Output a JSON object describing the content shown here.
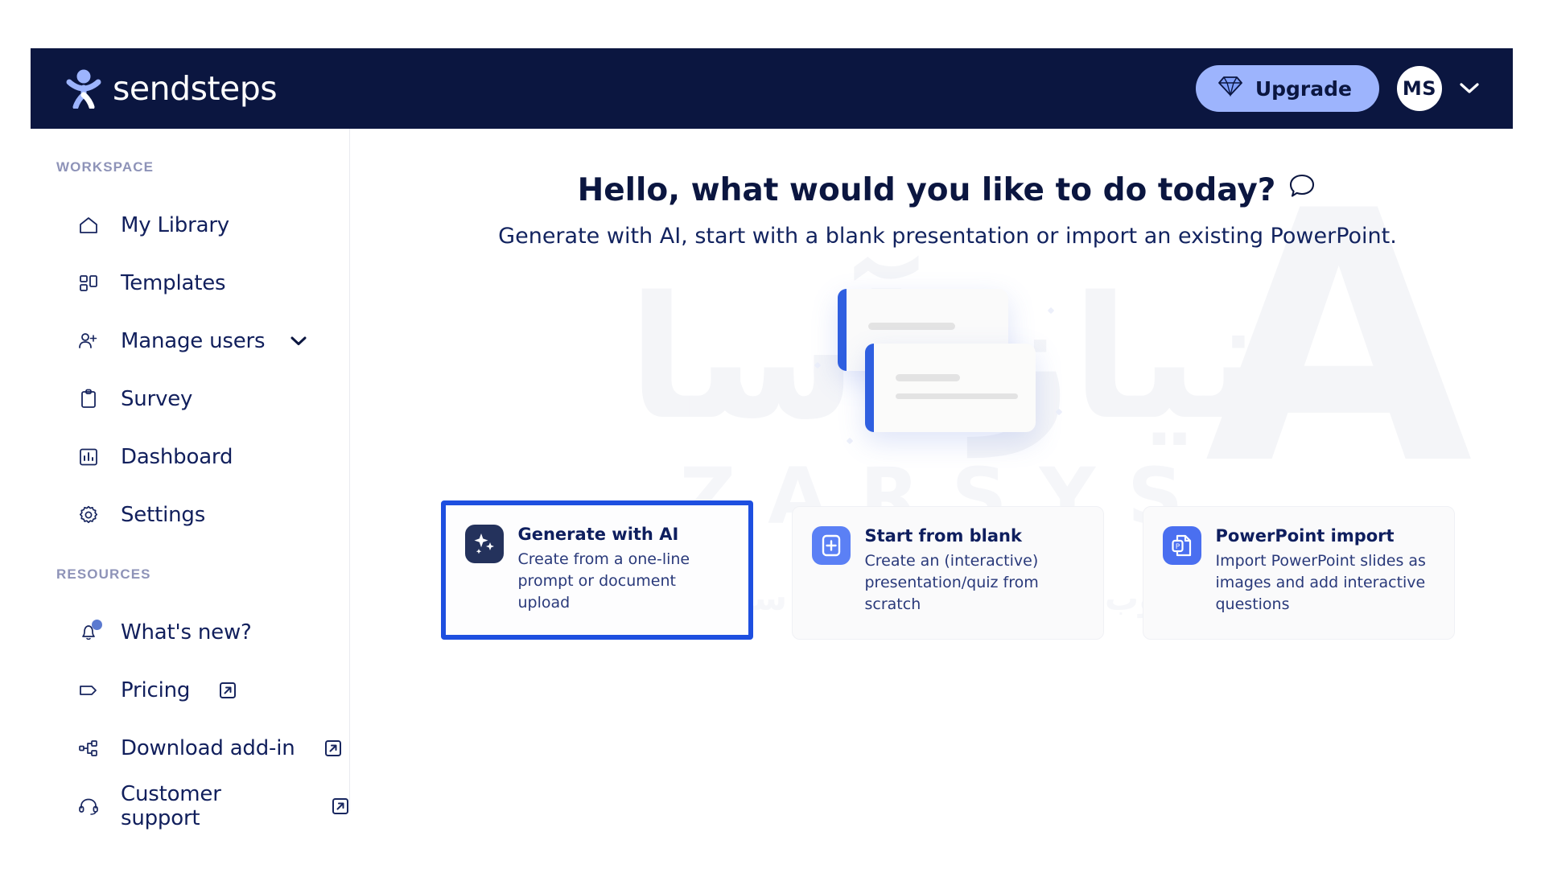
{
  "brand": {
    "name": "sendsteps",
    "logo_icon": "sendsteps-person-logo",
    "header_bg": "#0b1640",
    "accent": "#1e4fe0",
    "upgrade_bg": "#9db4fd"
  },
  "header": {
    "upgrade_label": "Upgrade",
    "upgrade_icon": "diamond-icon",
    "avatar_initials": "MS",
    "account_chevron_icon": "chevron-down-icon"
  },
  "sidebar": {
    "workspace_label": "WORKSPACE",
    "resources_label": "RESOURCES",
    "workspace_items": [
      {
        "label": "My Library",
        "icon": "home-icon",
        "chevron": false,
        "external": false,
        "badge": false
      },
      {
        "label": "Templates",
        "icon": "grid-icon",
        "chevron": false,
        "external": false,
        "badge": false
      },
      {
        "label": "Manage users",
        "icon": "user-add-icon",
        "chevron": true,
        "external": false,
        "badge": false
      },
      {
        "label": "Survey",
        "icon": "clipboard-icon",
        "chevron": false,
        "external": false,
        "badge": false
      },
      {
        "label": "Dashboard",
        "icon": "chart-icon",
        "chevron": false,
        "external": false,
        "badge": false
      },
      {
        "label": "Settings",
        "icon": "gear-icon",
        "chevron": false,
        "external": false,
        "badge": false
      }
    ],
    "resource_items": [
      {
        "label": "What's new?",
        "icon": "bell-icon",
        "chevron": false,
        "external": false,
        "badge": true
      },
      {
        "label": "Pricing",
        "icon": "tag-icon",
        "chevron": false,
        "external": true,
        "badge": false
      },
      {
        "label": "Download add-in",
        "icon": "plugin-icon",
        "chevron": false,
        "external": true,
        "badge": false
      },
      {
        "label": "Customer support",
        "icon": "headset-icon",
        "chevron": false,
        "external": true,
        "badge": false
      }
    ]
  },
  "main": {
    "title": "Hello, what would you like to do today?",
    "title_icon": "speech-bubble-icon",
    "subtitle": "Generate with AI, start with a blank presentation or import an existing PowerPoint.",
    "illustration_icon": "stacked-slides-illustration",
    "options": [
      {
        "title": "Generate with AI",
        "description": "Create from a one-line prompt or document upload",
        "icon": "sparkle-icon",
        "selected": true
      },
      {
        "title": "Start from blank",
        "description": "Create an (interactive) presentation/quiz from scratch",
        "icon": "plus-square-icon",
        "selected": false
      },
      {
        "title": "PowerPoint import",
        "description": "Import PowerPoint slides as images and add interactive questions",
        "icon": "powerpoint-file-icon",
        "selected": false
      }
    ]
  },
  "watermark": {
    "line1": "نیاز آسا",
    "line2": "ZARSYS",
    "line3": "بانی وب ، بانی ترین ، بانی سرویس"
  }
}
